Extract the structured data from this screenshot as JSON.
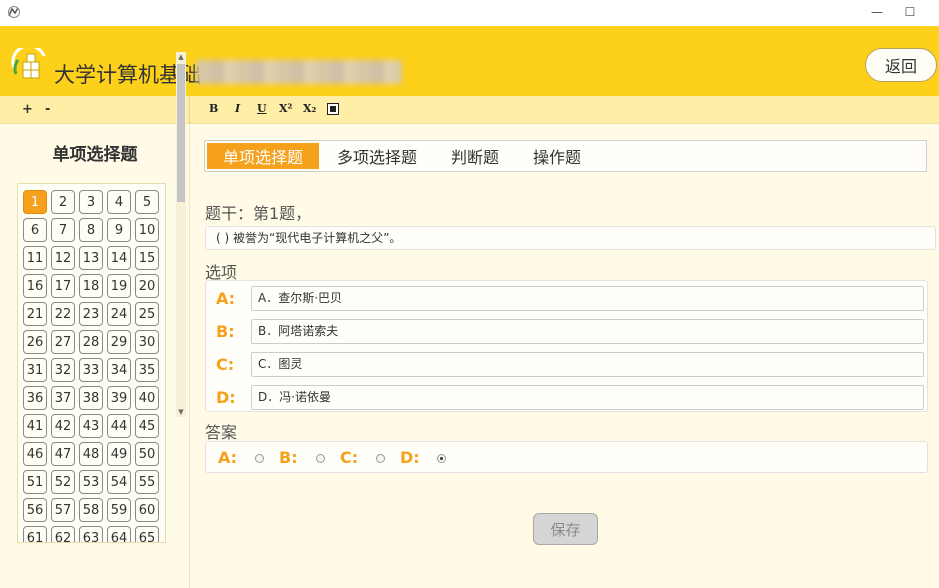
{
  "header": {
    "title": "大学计算机基础",
    "back_label": "返回"
  },
  "toolbar": {
    "zoom_in": "+",
    "zoom_out": "-",
    "bold": "B",
    "italic": "I",
    "underline": "U",
    "superscript": "X²",
    "subscript": "X₂",
    "insert_image_icon": "image-icon"
  },
  "left": {
    "title": "单项选择题",
    "current": "1",
    "questions": [
      "1",
      "2",
      "3",
      "4",
      "5",
      "6",
      "7",
      "8",
      "9",
      "10",
      "11",
      "12",
      "13",
      "14",
      "15",
      "16",
      "17",
      "18",
      "19",
      "20",
      "21",
      "22",
      "23",
      "24",
      "25",
      "26",
      "27",
      "28",
      "29",
      "30",
      "31",
      "32",
      "33",
      "34",
      "35",
      "36",
      "37",
      "38",
      "39",
      "40",
      "41",
      "42",
      "43",
      "44",
      "45",
      "46",
      "47",
      "48",
      "49",
      "50",
      "51",
      "52",
      "53",
      "54",
      "55",
      "56",
      "57",
      "58",
      "59",
      "60",
      "61",
      "62",
      "63",
      "64",
      "65"
    ]
  },
  "tabs": [
    {
      "label": "单项选择题",
      "active": true
    },
    {
      "label": "多项选择题",
      "active": false
    },
    {
      "label": "判断题",
      "active": false
    },
    {
      "label": "操作题",
      "active": false
    }
  ],
  "question": {
    "stem_label": "题干：第1题，",
    "stem_text": "( ) 被誉为“现代电子计算机之父”。",
    "options_label": "选项",
    "options": [
      {
        "letter": "A:",
        "text": "A．查尔斯·巴贝"
      },
      {
        "letter": "B:",
        "text": "B．阿塔诺索夫"
      },
      {
        "letter": "C:",
        "text": "C．图灵"
      },
      {
        "letter": "D:",
        "text": "D．冯·诺依曼"
      }
    ],
    "answer_label": "答案",
    "answers": [
      {
        "letter": "A:",
        "checked": false
      },
      {
        "letter": "B:",
        "checked": false
      },
      {
        "letter": "C:",
        "checked": false
      },
      {
        "letter": "D:",
        "checked": true
      }
    ]
  },
  "save_label": "保存",
  "colors": {
    "header": "#fdd019",
    "accent": "#f5a11c",
    "background": "#fffbe6"
  }
}
